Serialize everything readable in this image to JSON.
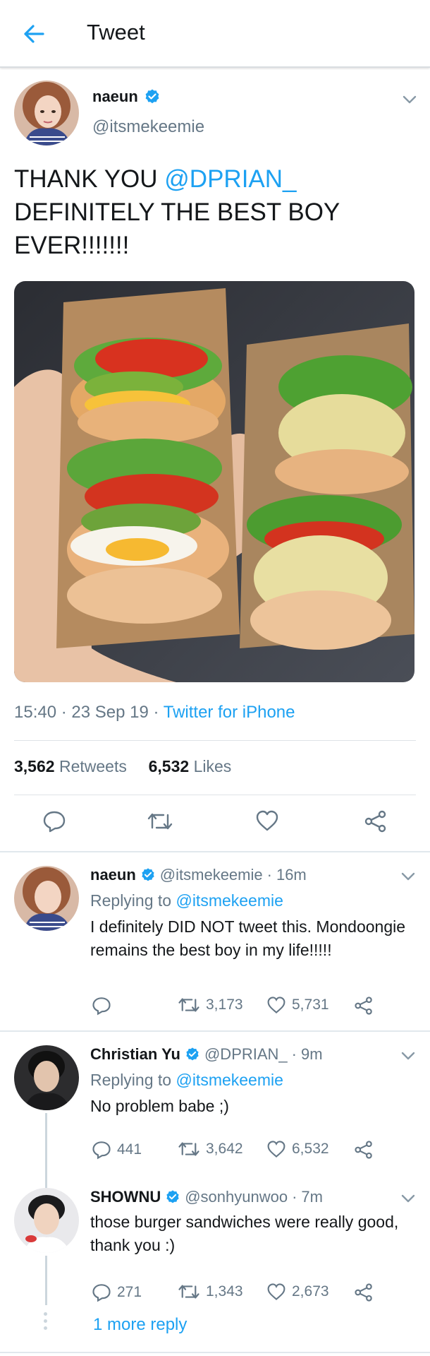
{
  "header": {
    "title": "Tweet",
    "back_icon": "arrow-left-icon"
  },
  "tweet": {
    "author_name": "naeun",
    "author_handle": "@itsmekeemie",
    "text_part1": "THANK YOU ",
    "text_mention": "@DPRIAN_",
    "text_part2": "DEFINITELY THE BEST BOY EVER!!!!!!!",
    "image_subject": "burger sandwiches",
    "time": "15:40",
    "date": "23 Sep 19",
    "source": "Twitter for iPhone",
    "retweets_count": "3,562",
    "retweets_label": "Retweets",
    "likes_count": "6,532",
    "likes_label": "Likes"
  },
  "replies": [
    {
      "name": "naeun",
      "handle": "@itsmekeemie",
      "time": "16m",
      "replying_label": "Replying to",
      "replying_to": "@itsmekeemie",
      "text": "I definitely DID NOT tweet this. Mondoongie remains the best boy in my life!!!!!",
      "reply_count": "",
      "retweet_count": "3,173",
      "like_count": "5,731"
    },
    {
      "name": "Christian Yu",
      "handle": "@DPRIAN_",
      "time": "9m",
      "replying_label": "Replying to",
      "replying_to": "@itsmekeemie",
      "text": "No problem babe ;)",
      "reply_count": "441",
      "retweet_count": "3,642",
      "like_count": "6,532"
    },
    {
      "name": "SHOWNU",
      "handle": "@sonhyunwoo",
      "time": "7m",
      "text": "those burger sandwiches were really good, thank you :)",
      "reply_count": "271",
      "retweet_count": "1,343",
      "like_count": "2,673"
    }
  ],
  "more_replies": "1 more reply",
  "colors": {
    "accent": "#1da1f2",
    "secondary_text": "#657786",
    "divider": "#e1e8ed"
  }
}
